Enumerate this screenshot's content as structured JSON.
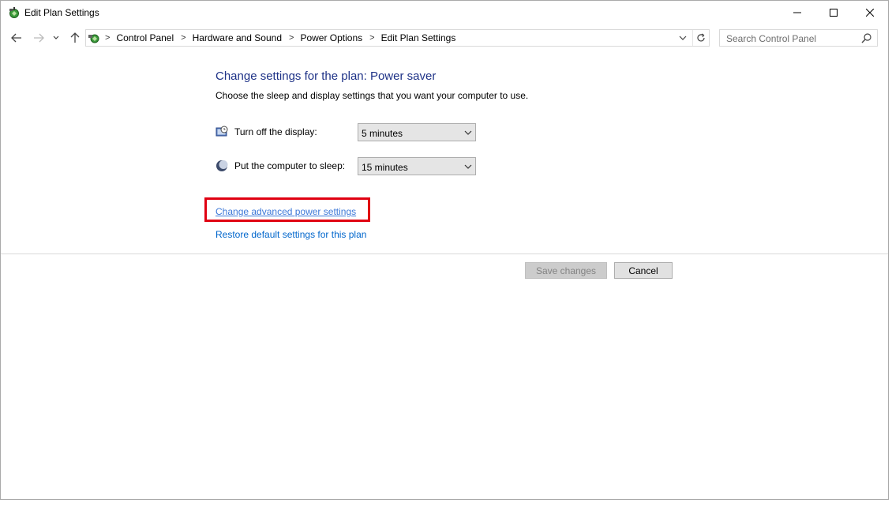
{
  "window": {
    "title": "Edit Plan Settings"
  },
  "nav": {
    "breadcrumbs": [
      "Control Panel",
      "Hardware and Sound",
      "Power Options",
      "Edit Plan Settings"
    ],
    "search_placeholder": "Search Control Panel"
  },
  "main": {
    "title": "Change settings for the plan: Power saver",
    "subtitle": "Choose the sleep and display settings that you want your computer to use.",
    "settings": [
      {
        "label": "Turn off the display:",
        "value": "5 minutes",
        "icon": "display-timer-icon"
      },
      {
        "label": "Put the computer to sleep:",
        "value": "15 minutes",
        "icon": "moon-sleep-icon"
      }
    ],
    "links": {
      "advanced": "Change advanced power settings",
      "restore": "Restore default settings for this plan"
    }
  },
  "footer": {
    "save_label": "Save changes",
    "cancel_label": "Cancel"
  },
  "colors": {
    "title_blue": "#1e3287",
    "link_blue": "#0066cc",
    "highlight_red": "#e00012"
  }
}
